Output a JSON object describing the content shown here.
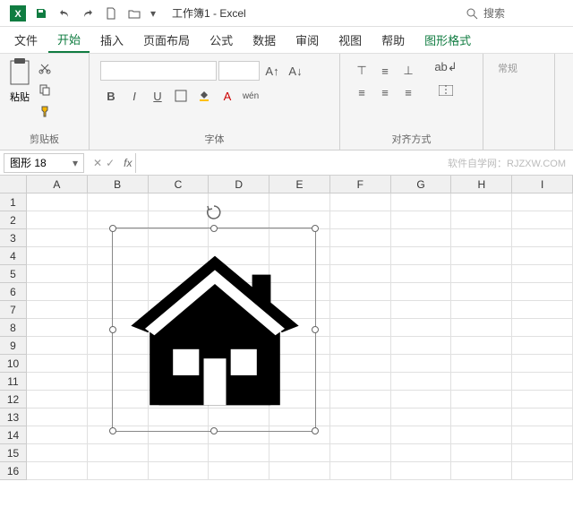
{
  "title": {
    "app": "工作簿1 - Excel"
  },
  "search": {
    "placeholder": "搜索"
  },
  "menu": {
    "file": "文件",
    "home": "开始",
    "insert": "插入",
    "layout": "页面布局",
    "formula": "公式",
    "data": "数据",
    "review": "审阅",
    "view": "视图",
    "help": "帮助",
    "shapefmt": "图形格式"
  },
  "ribbon": {
    "paste": "粘贴",
    "clipboard": "剪贴板",
    "font": "字体",
    "align": "对齐方式",
    "style_default": "常规"
  },
  "namebox": {
    "value": "图形 18"
  },
  "watermark": "软件自学网：RJZXW.COM",
  "cols": [
    "A",
    "B",
    "C",
    "D",
    "E",
    "F",
    "G",
    "H",
    "I"
  ],
  "rows": [
    "1",
    "2",
    "3",
    "4",
    "5",
    "6",
    "7",
    "8",
    "9",
    "10",
    "11",
    "12",
    "13",
    "14",
    "15",
    "16"
  ]
}
